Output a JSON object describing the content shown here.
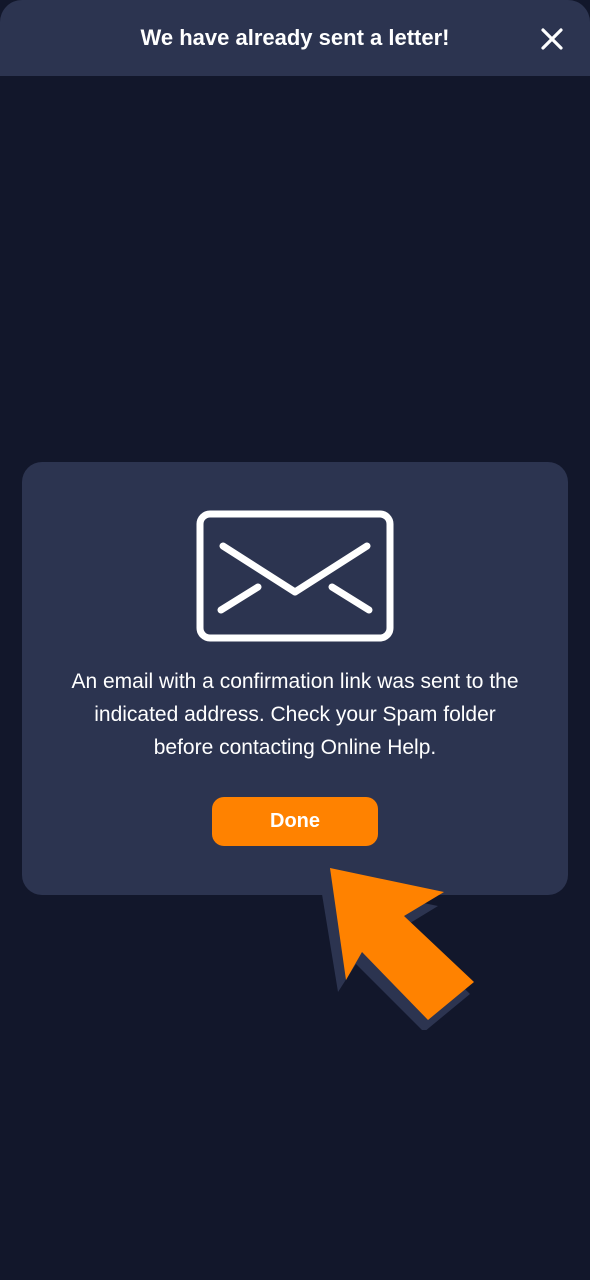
{
  "header": {
    "title": "We have already sent a letter!",
    "close_icon": "close-icon"
  },
  "dialog": {
    "icon": "envelope-icon",
    "message": "An email with a confirmation link was sent to the indicated address. Check your Spam folder before contacting Online Help.",
    "done_label": "Done"
  },
  "overlay": {
    "pointer_icon": "pointer-arrow-icon"
  },
  "colors": {
    "background": "#12172b",
    "panel": "#2c3450",
    "accent": "#ff8200",
    "text": "#ffffff"
  }
}
